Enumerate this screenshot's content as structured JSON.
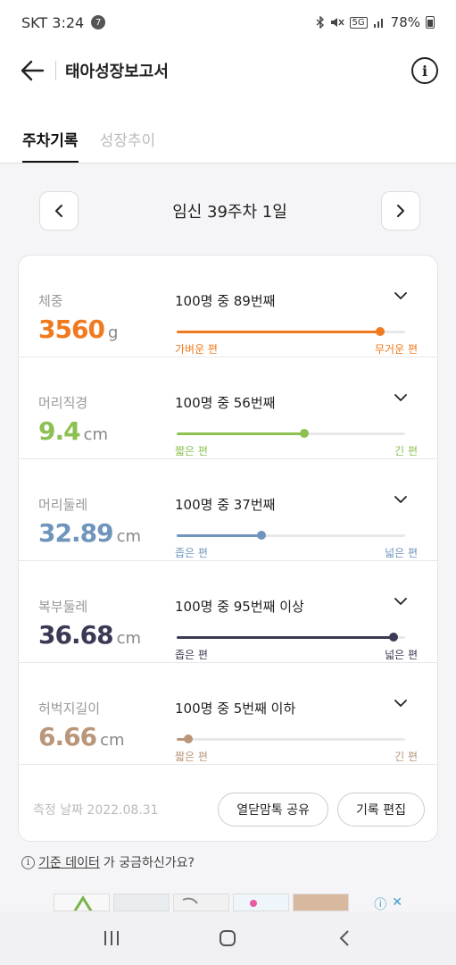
{
  "status_bar": {
    "carrier_time": "SKT 3:24",
    "notification_count": "7",
    "network_label": "5G",
    "battery": "78%"
  },
  "header": {
    "title": "태아성장보고서"
  },
  "tabs": [
    {
      "label": "주차기록",
      "active": true
    },
    {
      "label": "성장추이",
      "active": false
    }
  ],
  "week_nav": {
    "label": "임신 39주차 1일"
  },
  "metrics": [
    {
      "label": "체중",
      "value": "3560",
      "unit": "g",
      "rank": "100명 중 89번째",
      "left_label": "가벼운 편",
      "right_label": "무거운 편",
      "percentile": 0.89,
      "color": "#f07a1f"
    },
    {
      "label": "머리직경",
      "value": "9.4",
      "unit": "cm",
      "rank": "100명 중 56번째",
      "left_label": "짧은 편",
      "right_label": "긴 편",
      "percentile": 0.56,
      "color": "#8cc152"
    },
    {
      "label": "머리둘레",
      "value": "32.89",
      "unit": "cm",
      "rank": "100명 중 37번째",
      "left_label": "좁은 편",
      "right_label": "넓은 편",
      "percentile": 0.37,
      "color": "#6f95bd"
    },
    {
      "label": "복부둘레",
      "value": "36.68",
      "unit": "cm",
      "rank": "100명 중 95번째 이상",
      "left_label": "좁은 편",
      "right_label": "넓은 편",
      "percentile": 0.95,
      "color": "#3a3a55"
    },
    {
      "label": "허벅지길이",
      "value": "6.66",
      "unit": "cm",
      "rank": "100명 중 5번째 이하",
      "left_label": "짧은 편",
      "right_label": "긴 편",
      "percentile": 0.05,
      "color": "#b99679"
    }
  ],
  "footer": {
    "measure_date": "측정 날짜 2022.08.31",
    "share_label": "열닫맘톡 공유",
    "edit_label": "기록 편집"
  },
  "help": {
    "link_text": "기준 데이터",
    "rest_text": "가 궁금하신가요?"
  },
  "colors": {
    "accent_weight": "#f07a1f",
    "accent_head_diameter": "#8cc152",
    "accent_head_circumference": "#6f95bd",
    "accent_abdomen": "#3a3a55",
    "accent_femur": "#b99679"
  }
}
